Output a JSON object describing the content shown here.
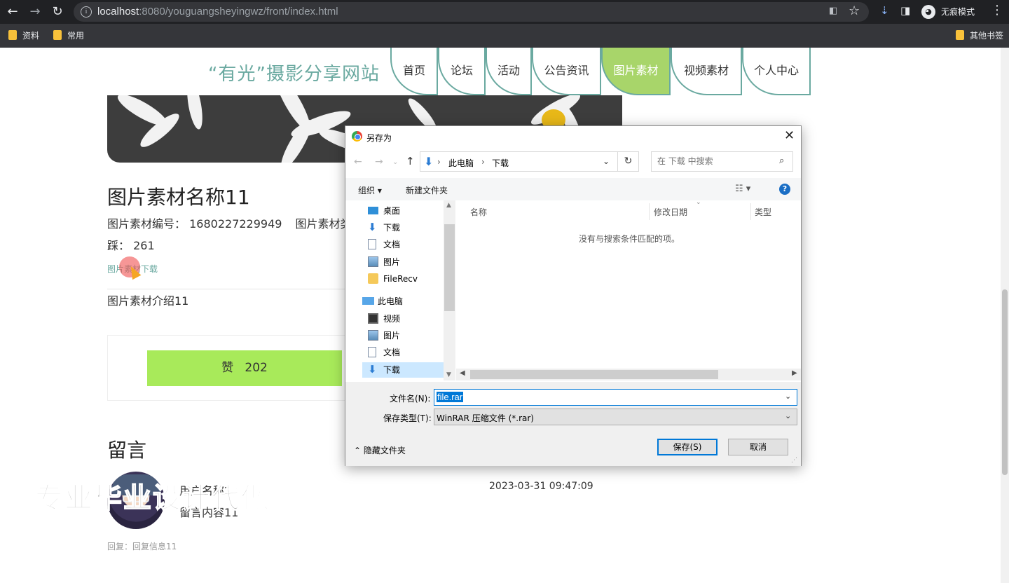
{
  "browser": {
    "url_host": "localhost",
    "url_rest": ":8080/youguangsheyingwz/front/index.html",
    "incognito_label": "无痕模式",
    "bookmarks": [
      "资料",
      "常用"
    ],
    "other_bookmarks": "其他书签"
  },
  "site": {
    "title": "“有光”摄影分享网站",
    "nav": [
      "首页",
      "论坛",
      "活动",
      "公告资讯",
      "图片素材",
      "视频素材",
      "个人中心"
    ],
    "active_nav": "图片素材"
  },
  "detail": {
    "name": "图片素材名称11",
    "code_label": "图片素材编号：",
    "code_value": "1680227229949",
    "type_label": "图片素材类",
    "dislike_label": "踩：",
    "dislike_value": "261",
    "download_link": "图片素材下载",
    "intro": "图片素材介绍11",
    "like_label": "赞",
    "like_value": "202"
  },
  "comments": {
    "heading": "留言",
    "items": [
      {
        "user": "用户名称2",
        "content": "留言内容11",
        "time": "2023-03-31 09:47:09",
        "reply": "回复：回复信息11"
      }
    ]
  },
  "watermark": "专业毕业设计代做",
  "dialog": {
    "title": "另存为",
    "path": [
      "此电脑",
      "下载"
    ],
    "search_placeholder": "在 下载 中搜索",
    "organize": "组织",
    "new_folder": "新建文件夹",
    "tree": [
      {
        "label": "桌面",
        "icon": "desktop-icon",
        "pinned": true
      },
      {
        "label": "下载",
        "icon": "download-icon",
        "pinned": true
      },
      {
        "label": "文档",
        "icon": "document-icon",
        "pinned": true
      },
      {
        "label": "图片",
        "icon": "picture-icon",
        "pinned": true
      },
      {
        "label": "FileRecv",
        "icon": "folder-icon",
        "pinned": true
      },
      {
        "label": "此电脑",
        "icon": "computer-icon",
        "pinned": false
      },
      {
        "label": "视频",
        "icon": "video-icon",
        "pinned": false
      },
      {
        "label": "图片",
        "icon": "picture-icon",
        "pinned": false
      },
      {
        "label": "文档",
        "icon": "document-icon",
        "pinned": false
      },
      {
        "label": "下载",
        "icon": "download-icon",
        "pinned": false
      }
    ],
    "columns": [
      "名称",
      "修改日期",
      "类型"
    ],
    "empty_message": "没有与搜索条件匹配的项。",
    "filename_label": "文件名(N):",
    "filename_value": "file.rar",
    "filetype_label": "保存类型(T):",
    "filetype_value": "WinRAR 压缩文件 (*.rar)",
    "hide_folders": "隐藏文件夹",
    "save_label": "保存(S)",
    "cancel_label": "取消"
  }
}
